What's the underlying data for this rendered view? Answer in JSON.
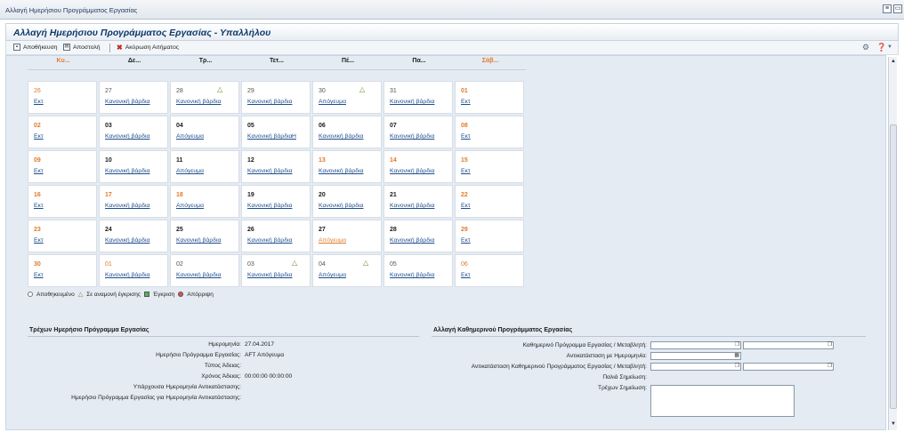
{
  "window": {
    "title": "Αλλαγή Ημερήσιου Προγράμματος Εργασίας"
  },
  "page": {
    "title": "Αλλαγή Ημερήσιου Προγράμματος Εργασίας - Υπαλλήλου"
  },
  "toolbar": {
    "save_label": "Αποθήκευση",
    "send_label": "Αποστολή",
    "cancel_label": "Ακύρωση Αιτήματος"
  },
  "calendar": {
    "days": [
      {
        "label": "Κυ...",
        "weekend": true
      },
      {
        "label": "Δε...",
        "weekend": false
      },
      {
        "label": "Τρ...",
        "weekend": false
      },
      {
        "label": "Τετ...",
        "weekend": false
      },
      {
        "label": "Πέ...",
        "weekend": false
      },
      {
        "label": "Πα...",
        "weekend": false
      },
      {
        "label": "Σάβ...",
        "weekend": true
      }
    ],
    "weeks": [
      [
        {
          "day": "26",
          "link": "Εκτ",
          "weekend": true,
          "faded": true
        },
        {
          "day": "27",
          "link": "Κανονική βάρδια",
          "faded": true
        },
        {
          "day": "28",
          "link": "Κανονική βάρδια",
          "faded": true,
          "pending": true
        },
        {
          "day": "29",
          "link": "Κανονική βάρδια",
          "faded": true
        },
        {
          "day": "30",
          "link": "Απόγευμα",
          "faded": true,
          "pending": true
        },
        {
          "day": "31",
          "link": "Κανονική βάρδια",
          "faded": true
        },
        {
          "day": "01",
          "link": "Εκτ",
          "weekend": true
        }
      ],
      [
        {
          "day": "02",
          "link": "Εκτ",
          "weekend": true
        },
        {
          "day": "03",
          "link": "Κανονική βάρδια"
        },
        {
          "day": "04",
          "link": "Απόγευμα"
        },
        {
          "day": "05",
          "link": "Κανονική βάρδια",
          "extra": "Η"
        },
        {
          "day": "06",
          "link": "Κανονική βάρδια"
        },
        {
          "day": "07",
          "link": "Κανονική βάρδια"
        },
        {
          "day": "08",
          "link": "Εκτ",
          "weekend": true
        }
      ],
      [
        {
          "day": "09",
          "link": "Εκτ",
          "weekend": true
        },
        {
          "day": "10",
          "link": "Κανονική βάρδια"
        },
        {
          "day": "11",
          "link": "Απόγευμα"
        },
        {
          "day": "12",
          "link": "Κανονική βάρδια"
        },
        {
          "day": "13",
          "link": "Κανονική βάρδια",
          "weekend": true
        },
        {
          "day": "14",
          "link": "Κανονική βάρδια",
          "weekend": true
        },
        {
          "day": "15",
          "link": "Εκτ",
          "weekend": true
        }
      ],
      [
        {
          "day": "16",
          "link": "Εκτ",
          "weekend": true
        },
        {
          "day": "17",
          "link": "Κανονική βάρδια",
          "weekend": true
        },
        {
          "day": "18",
          "link": "Απόγευμα",
          "weekend": true
        },
        {
          "day": "19",
          "link": "Κανονική βάρδια"
        },
        {
          "day": "20",
          "link": "Κανονική βάρδια"
        },
        {
          "day": "21",
          "link": "Κανονική βάρδια"
        },
        {
          "day": "22",
          "link": "Εκτ",
          "weekend": true
        }
      ],
      [
        {
          "day": "23",
          "link": "Εκτ",
          "weekend": true
        },
        {
          "day": "24",
          "link": "Κανονική βάρδια"
        },
        {
          "day": "25",
          "link": "Κανονική βάρδια"
        },
        {
          "day": "26",
          "link": "Κανονική βάρδια"
        },
        {
          "day": "27",
          "link": "Απόγευμα",
          "orange_link": true
        },
        {
          "day": "28",
          "link": "Κανονική βάρδια"
        },
        {
          "day": "29",
          "link": "Εκτ",
          "weekend": true
        }
      ],
      [
        {
          "day": "30",
          "link": "Εκτ",
          "weekend": true
        },
        {
          "day": "01",
          "link": "Κανονική βάρδια",
          "weekend": true,
          "faded": true
        },
        {
          "day": "02",
          "link": "Κανονική βάρδια",
          "faded": true
        },
        {
          "day": "03",
          "link": "Κανονική βάρδια",
          "faded": true,
          "pending": true
        },
        {
          "day": "04",
          "link": "Απόγευμα",
          "faded": true,
          "pending": true
        },
        {
          "day": "05",
          "link": "Κανονική βάρδια",
          "faded": true
        },
        {
          "day": "06",
          "link": "Εκτ",
          "weekend": true,
          "faded": true
        }
      ]
    ]
  },
  "legend": {
    "saved": "Αποθηκευμένο",
    "pending": "Σε αναμονή έγκρισης",
    "approved": "Έγκριση",
    "rejected": "Απόρριψη"
  },
  "current": {
    "title": "Τρέχων Ημερήσιο Πρόγραμμα Εργασίας",
    "date_label": "Ημερομηνία:",
    "date_value": "27.04.2017",
    "schedule_label": "Ημερήσιο Πρόγραμμα Εργασίας:",
    "schedule_value": "AFT Απόγευμα",
    "leave_type_label": "Τύπος Άδειας:",
    "leave_time_label": "Χρόνος Άδειας:",
    "leave_time_value": "00:00:00 00:00:00",
    "existing_date_label": "Υπάρχουσα Ημερομηνία Αντικατάστασης:",
    "replacement_schedule_label": "Ημερήσιο Πρόγραμμα Εργασίας για Ημερομηνία Αντικατάστασης:"
  },
  "change": {
    "title": "Αλλαγή Καθημερινού Προγράμματος Εργασίας",
    "schedule_var_label": "Καθημερινό Πρόγραμμα Εργασίας / Μεταβλητή:",
    "replace_with_date_label": "Αντικατάσταση με Ημερομηνία:",
    "replace_schedule_label": "Αντικατάσταση Καθημερινού Προγράμματος Εργασίας / Μεταβλητή:",
    "old_note_label": "Παλιά Σημείωση:",
    "current_note_label": "Τρέχων Σημείωση:"
  }
}
